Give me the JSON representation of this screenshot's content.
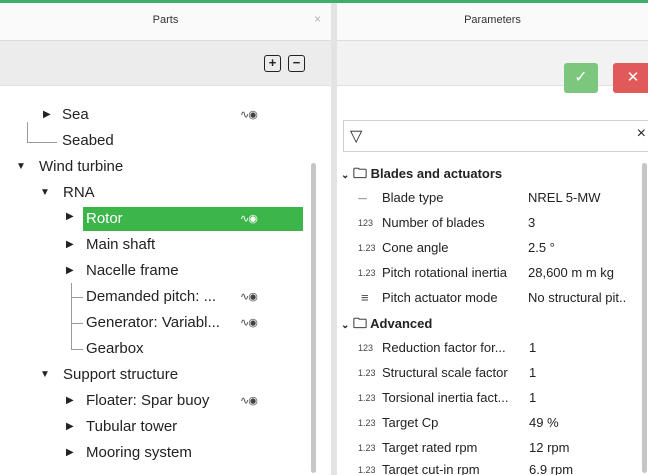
{
  "parts_panel": {
    "title": "Parts",
    "close": "×",
    "add_label": "+",
    "remove_label": "−",
    "tree": [
      {
        "label": "Sea"
      },
      {
        "label": "Seabed"
      },
      {
        "label": "Wind turbine"
      },
      {
        "label": "RNA"
      },
      {
        "label": "Rotor"
      },
      {
        "label": "Main shaft"
      },
      {
        "label": "Nacelle frame"
      },
      {
        "label": "Demanded pitch: ..."
      },
      {
        "label": "Generator: Variabl..."
      },
      {
        "label": "Gearbox"
      },
      {
        "label": "Support structure"
      },
      {
        "label": "Floater: Spar buoy"
      },
      {
        "label": "Tubular tower"
      },
      {
        "label": "Mooring system"
      }
    ]
  },
  "parameters_panel": {
    "title": "Parameters",
    "ok_label": "✓",
    "cancel_label": "✕",
    "filter_icon": "▽",
    "filter_clear": "×",
    "groups": [
      {
        "label": "Blades and actuators",
        "items": [
          {
            "type_icon": "—",
            "label": "Blade type",
            "value": "NREL 5-MW"
          },
          {
            "type_icon": "123",
            "label": "Number of blades",
            "value": "3"
          },
          {
            "type_icon": "1.23",
            "label": "Cone angle",
            "value": "2.5 °"
          },
          {
            "type_icon": "1.23",
            "label": "Pitch rotational inertia",
            "value": "28,600 m m kg"
          },
          {
            "type_icon": "≡",
            "label": "Pitch actuator mode",
            "value": "No structural pit.."
          }
        ]
      },
      {
        "label": "Advanced",
        "items": [
          {
            "type_icon": "123",
            "label": "Reduction factor for...",
            "value": "1"
          },
          {
            "type_icon": "1.23",
            "label": "Structural scale factor",
            "value": "1"
          },
          {
            "type_icon": "1.23",
            "label": "Torsional inertia fact...",
            "value": "1"
          },
          {
            "type_icon": "1.23",
            "label": "Target Cp",
            "value": "49 %"
          },
          {
            "type_icon": "1.23",
            "label": "Target rated rpm",
            "value": "12 rpm"
          },
          {
            "type_icon": "1.23",
            "label": "Target cut-in rpm",
            "value": "6.9 rpm"
          }
        ]
      }
    ]
  },
  "colors": {
    "accent": "#3cb54a",
    "cancel": "#e05a5a",
    "ok": "#7cc77e"
  }
}
